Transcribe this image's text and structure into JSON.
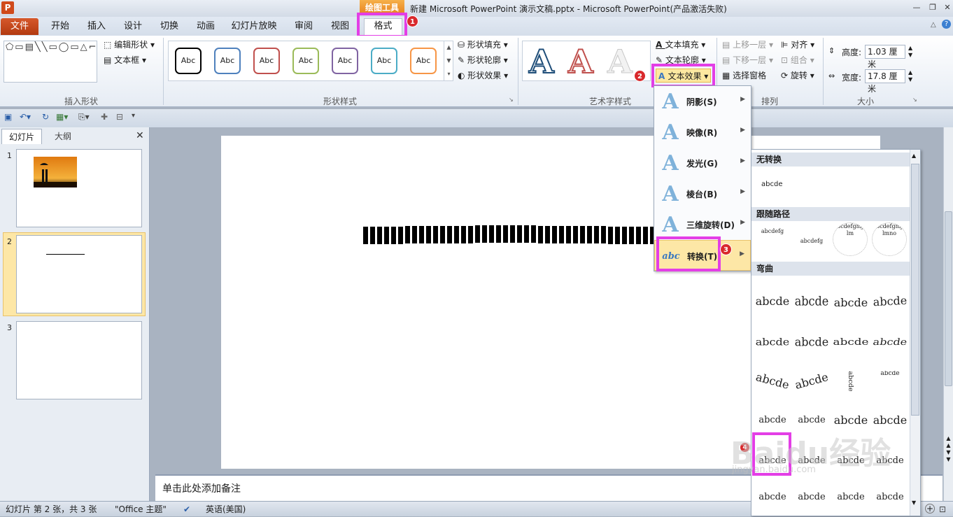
{
  "titlebar": {
    "app_icon": "P",
    "tools_banner": "绘图工具",
    "title": "新建 Microsoft PowerPoint 演示文稿.pptx  -  Microsoft PowerPoint(产品激活失败)",
    "min": "—",
    "restore": "❐",
    "close": "✕"
  },
  "menu": {
    "file": "文件",
    "tabs": [
      "开始",
      "插入",
      "设计",
      "切换",
      "动画",
      "幻灯片放映",
      "审阅",
      "视图"
    ],
    "format": "格式"
  },
  "badges": [
    "1",
    "2",
    "3",
    "4"
  ],
  "ribbon": {
    "insert_shapes": {
      "label": "插入形状",
      "edit_shape": "编辑形状",
      "textbox": "文本框",
      "glyphs": "⬠▭▤╲╲▭◯▭△⌐⌐⇨⇩▢◸╲╲↘"
    },
    "shape_styles": {
      "label": "形状样式",
      "items": [
        "Abc",
        "Abc",
        "Abc",
        "Abc",
        "Abc",
        "Abc",
        "Abc"
      ],
      "colors": [
        "#000000",
        "#4f81bd",
        "#c0504d",
        "#9bbb59",
        "#8064a2",
        "#4bacc6",
        "#f79646"
      ],
      "fill": "形状填充",
      "outline": "形状轮廓",
      "effects": "形状效果"
    },
    "wordart": {
      "label": "艺术字样式",
      "letter": "A",
      "text_fill": "文本填充",
      "text_outline": "文本轮廓",
      "text_effects": "文本效果"
    },
    "arrange": {
      "label": "排列",
      "bring_forward": "上移一层",
      "send_backward": "下移一层",
      "selection_pane": "选择窗格",
      "align": "对齐",
      "group": "组合",
      "rotate": "旋转"
    },
    "size": {
      "label": "大小",
      "height_label": "高度:",
      "height": "1.03 厘米",
      "width_label": "宽度:",
      "width": "17.8 厘米"
    }
  },
  "left_pane": {
    "tab_slides": "幻灯片",
    "tab_outline": "大纲",
    "close": "✕",
    "slides": [
      "1",
      "2",
      "3"
    ]
  },
  "notes": "单击此处添加备注",
  "status": {
    "slide": "幻灯片 第 2 张，共 3 张",
    "theme": "\"Office 主题\"",
    "lang": "英语(美国)"
  },
  "text_effects_menu": [
    {
      "label": "阴影(S)",
      "icon": "A"
    },
    {
      "label": "映像(R)",
      "icon": "A"
    },
    {
      "label": "发光(G)",
      "icon": "A"
    },
    {
      "label": "棱台(B)",
      "icon": "A"
    },
    {
      "label": "三维旋转(D)",
      "icon": "A"
    },
    {
      "label": "转换(T)",
      "icon": "abc"
    }
  ],
  "transform_menu": {
    "no_transform": "无转换",
    "no_transform_sample": "abcde",
    "follow_path": "跟随路径",
    "path_samples": [
      "abcdefg",
      "abcdefg",
      "abcdefghijklm",
      "abcdefghijklmno"
    ],
    "warp": "弯曲",
    "warp_samples": [
      "abcde",
      "abcde",
      "abcde",
      "abcde",
      "abcde",
      "abcde",
      "abcde",
      "abcde",
      "abcde",
      "abcde",
      "abcde",
      "abcde",
      "abcde",
      "abcde",
      "abcde",
      "abcde",
      "abcde",
      "abcde",
      "abcde",
      "abcde",
      "abcde",
      "abcde",
      "abcde",
      "abcde"
    ]
  },
  "watermark": "Baidu经验",
  "watermark_url": "jingyan.baidu.com"
}
